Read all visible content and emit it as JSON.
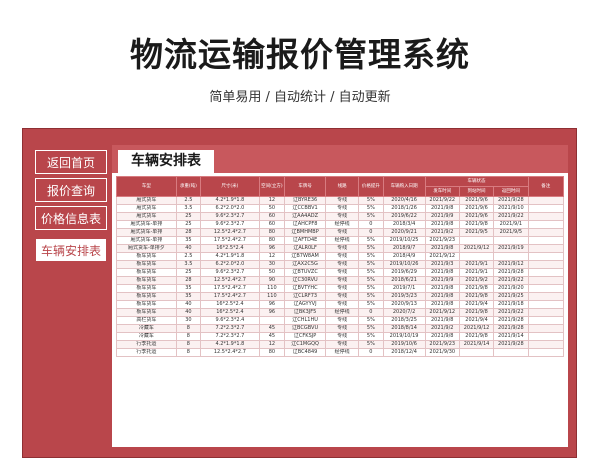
{
  "header": {
    "title": "物流运输报价管理系统",
    "subtitle": "简单易用 / 自动统计 / 自动更新"
  },
  "nav": {
    "items": [
      {
        "label": "返回首页"
      },
      {
        "label": "报价查询"
      },
      {
        "label": "价格信息表"
      },
      {
        "label": "车辆安排表"
      }
    ]
  },
  "tab": {
    "label": "车辆安排表"
  },
  "colors": {
    "accent": "#b9464b",
    "accent_light": "#c8585d",
    "row_alt": "#fbf1f1"
  },
  "table": {
    "headers": [
      "车型",
      "承重(吨)",
      "尺寸(米)",
      "空间(立方)",
      "车牌号",
      "线路",
      "价格提升",
      "车辆购入日期",
      "车辆状态",
      "备注"
    ],
    "status_headers": [
      "发车时间",
      "到站时间",
      "返回时间"
    ],
    "rows": [
      [
        "厢式货车",
        "2.5",
        "4.2*1.9*1.8",
        "12",
        "辽BYRE36",
        "专线",
        "5%",
        "2020/4/16",
        "2021/9/22",
        "2021/9/6",
        "2021/9/28",
        ""
      ],
      [
        "厢式货车",
        "3.5",
        "6.2*2.0*2.0",
        "50",
        "辽CCBBV1",
        "专线",
        "5%",
        "2018/1/26",
        "2021/9/8",
        "2021/9/6",
        "2021/9/10",
        ""
      ],
      [
        "厢式货车",
        "25",
        "9.6*2.3*2.7",
        "60",
        "辽AA4ADZ",
        "专线",
        "5%",
        "2019/6/22",
        "2021/9/9",
        "2021/9/6",
        "2021/9/22",
        ""
      ],
      [
        "厢式货车-单排",
        "25",
        "9.6*2.3*2.7",
        "60",
        "辽AHCPF8",
        "经停线",
        "0",
        "2018/3/4",
        "2021/9/8",
        "2021/9/8",
        "2021/9/1",
        ""
      ],
      [
        "厢式货车-单排",
        "28",
        "12.5*2.4*2.7",
        "80",
        "辽BMHMBP",
        "专线",
        "0",
        "2020/9/21",
        "2021/9/2",
        "2021/9/5",
        "2021/9/5",
        ""
      ],
      [
        "厢式货车-单排",
        "35",
        "17.5*2.4*2.7",
        "80",
        "辽AFTD4E",
        "经停线",
        "5%",
        "2019/10/25",
        "2021/9/23",
        "",
        "",
        ""
      ],
      [
        "厢式货车-单排夕",
        "40",
        "16*2.5*2.4",
        "96",
        "辽ALR0LF",
        "专线",
        "5%",
        "2018/9/7",
        "2021/9/8",
        "2021/9/12",
        "2021/9/19",
        ""
      ],
      [
        "板车货车",
        "2.5",
        "4.2*1.9*1.8",
        "12",
        "辽B7W8AM",
        "专线",
        "5%",
        "2018/4/9",
        "2021/9/12",
        "",
        "",
        ""
      ],
      [
        "板车货车",
        "3.5",
        "6.2*2.0*2.0",
        "30",
        "辽AX2C5G",
        "专线",
        "5%",
        "2019/10/26",
        "2021/9/3",
        "2021/9/1",
        "2021/9/12",
        ""
      ],
      [
        "板车货车",
        "25",
        "9.6*2.3*2.7",
        "50",
        "辽BTUVZC",
        "专线",
        "5%",
        "2019/6/29",
        "2021/9/8",
        "2021/9/1",
        "2021/9/28",
        ""
      ],
      [
        "板车货车",
        "28",
        "12.5*2.4*2.7",
        "90",
        "辽C30RVU",
        "专线",
        "5%",
        "2018/6/21",
        "2021/9/9",
        "2021/9/2",
        "2021/9/22",
        ""
      ],
      [
        "板车货车",
        "35",
        "17.5*2.4*2.7",
        "110",
        "辽BVTYHC",
        "专线",
        "5%",
        "2019/7/1",
        "2021/9/8",
        "2021/9/8",
        "2021/9/20",
        ""
      ],
      [
        "板车货车",
        "35",
        "17.5*2.4*2.7",
        "110",
        "辽CLRF73",
        "专线",
        "5%",
        "2019/3/23",
        "2021/9/8",
        "2021/9/8",
        "2021/9/25",
        ""
      ],
      [
        "板车货车",
        "40",
        "16*2.5*2.4",
        "96",
        "辽AGYYVJ",
        "专线",
        "5%",
        "2020/9/13",
        "2021/9/8",
        "2021/9/4",
        "2021/9/18",
        ""
      ],
      [
        "板车货车",
        "40",
        "16*2.5*2.4",
        "96",
        "辽BK3JF5",
        "经停线",
        "0",
        "2020/7/2",
        "2021/9/12",
        "2021/9/8",
        "2021/9/22",
        ""
      ],
      [
        "高栏货车",
        "30",
        "9.6*2.3*2.4",
        "",
        "辽CHL1HU",
        "专线",
        "5%",
        "2018/3/25",
        "2021/9/8",
        "2021/9/4",
        "2021/9/28",
        ""
      ],
      [
        "冷藏车",
        "8",
        "7.2*2.3*2.7",
        "45",
        "辽BCGBVU",
        "专线",
        "5%",
        "2018/8/14",
        "2021/9/2",
        "2021/9/12",
        "2021/9/28",
        ""
      ],
      [
        "冷藏车",
        "8",
        "7.2*2.3*2.7",
        "45",
        "辽CFKSJP",
        "专线",
        "5%",
        "2019/10/19",
        "2021/9/8",
        "2021/9/8",
        "2021/9/14",
        ""
      ],
      [
        "行李托运",
        "8",
        "4.2*1.9*1.8",
        "12",
        "辽C1MGQQ",
        "专线",
        "5%",
        "2019/10/6",
        "2021/9/23",
        "2021/9/14",
        "2021/9/28",
        ""
      ],
      [
        "行李托运",
        "8",
        "12.5*2.4*2.7",
        "80",
        "辽BC4849",
        "经停线",
        "0",
        "2018/12/4",
        "2021/9/30",
        "",
        "",
        ""
      ]
    ]
  }
}
